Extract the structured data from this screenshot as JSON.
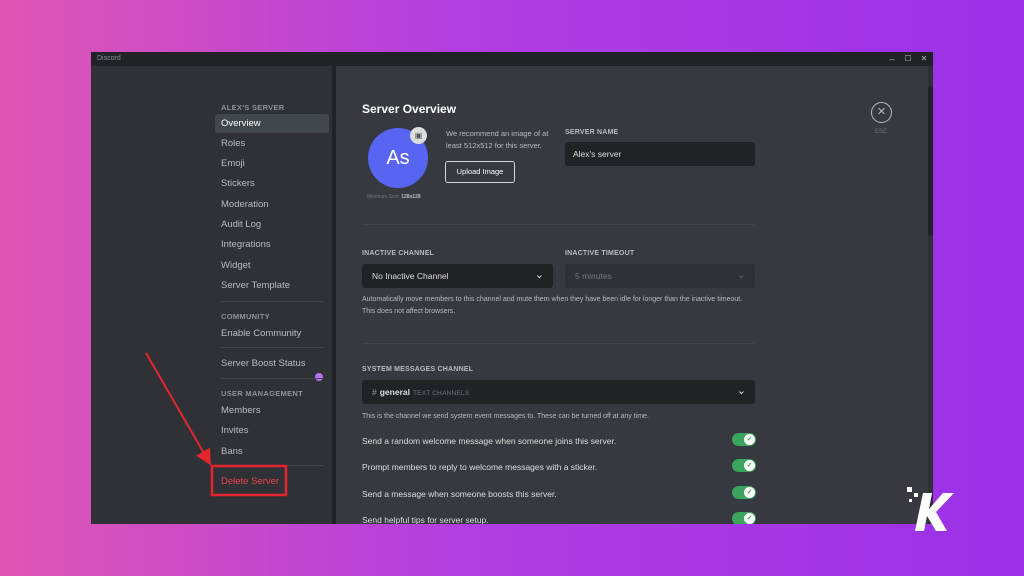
{
  "window": {
    "title": "Discord",
    "minimize": "–",
    "maximize": "☐",
    "close": "✕"
  },
  "sidebar": {
    "server_section": "ALEX'S SERVER",
    "server_items": [
      {
        "label": "Overview",
        "active": true
      },
      {
        "label": "Roles"
      },
      {
        "label": "Emoji"
      },
      {
        "label": "Stickers"
      },
      {
        "label": "Moderation"
      },
      {
        "label": "Audit Log"
      },
      {
        "label": "Integrations"
      },
      {
        "label": "Widget"
      },
      {
        "label": "Server Template"
      }
    ],
    "community_section": "COMMUNITY",
    "community_items": [
      {
        "label": "Enable Community"
      },
      {
        "label": "Server Boost Status"
      }
    ],
    "user_mgmt_section": "USER MANAGEMENT",
    "user_mgmt_items": [
      {
        "label": "Members"
      },
      {
        "label": "Invites"
      },
      {
        "label": "Bans"
      }
    ],
    "delete_server": "Delete Server"
  },
  "main": {
    "title": "Server Overview",
    "avatar_initials": "As",
    "min_size_label": "Minimum Size:",
    "min_size_value": "128x128",
    "image_recommendation": "We recommend an image of at least 512x512 for this server.",
    "upload_button": "Upload Image",
    "server_name_label": "SERVER NAME",
    "server_name_value": "Alex's server",
    "inactive_channel_label": "INACTIVE CHANNEL",
    "inactive_channel_value": "No Inactive Channel",
    "inactive_timeout_label": "INACTIVE TIMEOUT",
    "inactive_timeout_value": "5 minutes",
    "inactive_help": "Automatically move members to this channel and mute them when they have been idle for longer than the inactive timeout. This does not affect browsers.",
    "system_channel_label": "SYSTEM MESSAGES CHANNEL",
    "system_channel_hash": "#",
    "system_channel_name": "general",
    "system_channel_category": "TEXT CHANNELS",
    "system_help": "This is the channel we send system event messages to. These can be turned off at any time.",
    "toggles": [
      {
        "label": "Send a random welcome message when someone joins this server.",
        "on": true
      },
      {
        "label": "Prompt members to reply to welcome messages with a sticker.",
        "on": true
      },
      {
        "label": "Send a message when someone boosts this server.",
        "on": true
      },
      {
        "label": "Send helpful tips for server setup.",
        "on": true
      }
    ],
    "esc_label": "ESC"
  },
  "annotation": {
    "color": "#e3262e"
  },
  "colors": {
    "accent": "#5865f2",
    "toggle_on": "#3ba55d",
    "danger": "#ed4245"
  }
}
